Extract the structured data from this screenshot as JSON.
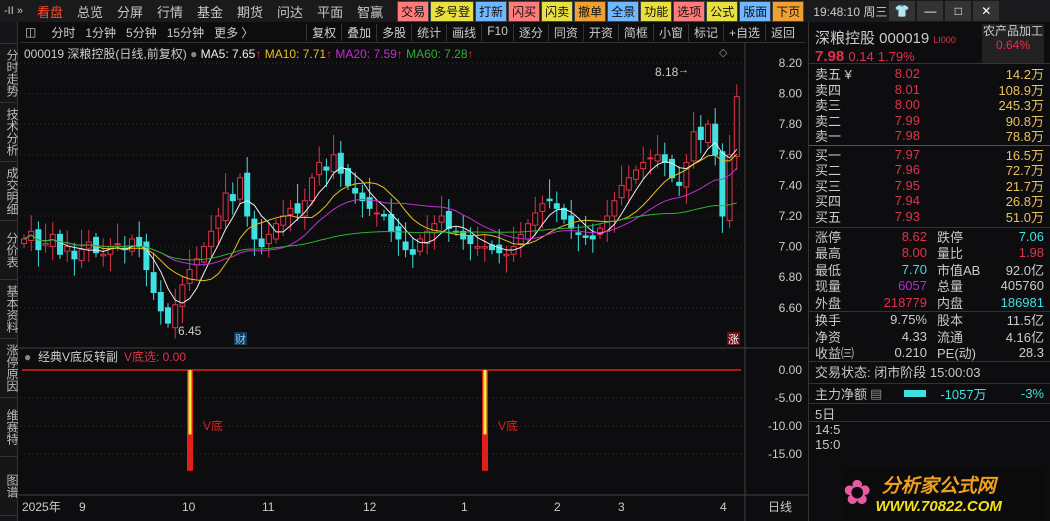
{
  "topbar": {
    "logo": "-II »",
    "nav": [
      "看盘",
      "总览",
      "分屏",
      "行情",
      "基金",
      "期货",
      "问达",
      "平面",
      "智赢"
    ],
    "functions": [
      {
        "label": "交易",
        "color": "#ff7a7a"
      },
      {
        "label": "多号登",
        "color": "#e8e040"
      },
      {
        "label": "打新",
        "color": "#6fb8ff"
      },
      {
        "label": "闪买",
        "color": "#ff7a7a"
      },
      {
        "label": "闪卖",
        "color": "#e8e040"
      },
      {
        "label": "撤单",
        "color": "#f0a030"
      },
      {
        "label": "全景",
        "color": "#6fb8ff"
      },
      {
        "label": "功能",
        "color": "#e8e040"
      },
      {
        "label": "选项",
        "color": "#ff7a7a"
      },
      {
        "label": "公式",
        "color": "#e8e040"
      },
      {
        "label": "版面",
        "color": "#6fb8ff"
      },
      {
        "label": "下页",
        "color": "#f0a030"
      }
    ],
    "clock": "19:48:10 周三"
  },
  "toolbar": {
    "left": [
      "分时",
      "1分钟",
      "5分钟",
      "15分钟",
      "更多 〉"
    ],
    "right": [
      "复权",
      "叠加",
      "多股",
      "统计",
      "画线",
      "F10",
      "逐分",
      "同资",
      "开资",
      "简框",
      "小窗",
      "标记",
      "+自选",
      "返回"
    ]
  },
  "sidebar": [
    "分时走势",
    "技术分析",
    "成交明细",
    "分价表",
    "基本资料",
    "涨停原因",
    "维赛特",
    "图谱"
  ],
  "chart": {
    "title": "000019 深粮控股(日线,前复权)",
    "ma5": "MA5: 7.65",
    "ma10": "MA10: 7.71",
    "ma20": "MA20: 7.59",
    "ma60": "MA60: 7.28",
    "high_label": "8.18",
    "low_label": "6.45",
    "marker_cai": "财",
    "marker_zhang": "涨",
    "y_ticks": [
      "8.20",
      "8.00",
      "7.80",
      "7.60",
      "7.40",
      "7.20",
      "7.00",
      "6.80",
      "6.60"
    ],
    "indicator_title": "经典V底反转副",
    "indicator_value": "V底选: 0.00",
    "indicator_ticks": [
      "0.00",
      "-5.00",
      "-10.00",
      "-15.00"
    ],
    "signal_label": "V底",
    "x_labels": [
      "2025年",
      "9",
      "10",
      "11",
      "12",
      "1",
      "2",
      "3",
      "4"
    ],
    "period": "日线"
  },
  "chart_data": {
    "type": "candlestick",
    "closes": [
      7.05,
      7.1,
      6.98,
      7.02,
      7.08,
      6.95,
      7.0,
      6.92,
      6.98,
      7.03,
      6.96,
      6.95,
      7.0,
      7.02,
      6.98,
      7.05,
      7.0,
      6.85,
      6.7,
      6.58,
      6.5,
      6.62,
      6.75,
      6.85,
      6.92,
      7.0,
      7.1,
      7.2,
      7.35,
      7.3,
      7.45,
      7.2,
      7.05,
      7.0,
      7.08,
      7.15,
      7.2,
      7.25,
      7.22,
      7.3,
      7.45,
      7.55,
      7.5,
      7.6,
      7.48,
      7.4,
      7.35,
      7.3,
      7.25,
      7.22,
      7.2,
      7.1,
      7.05,
      6.98,
      6.95,
      7.05,
      7.1,
      7.15,
      7.2,
      7.12,
      7.1,
      7.05,
      7.02,
      7.0,
      7.0,
      6.98,
      6.96,
      6.95,
      7.0,
      7.08,
      7.15,
      7.22,
      7.28,
      7.3,
      7.25,
      7.18,
      7.12,
      7.08,
      7.06,
      7.05,
      7.12,
      7.2,
      7.3,
      7.4,
      7.45,
      7.5,
      7.55,
      7.58,
      7.6,
      7.55,
      7.45,
      7.4,
      7.55,
      7.75,
      7.7,
      7.8,
      7.6,
      7.2,
      7.6,
      7.98
    ],
    "ylim": [
      6.4,
      8.3
    ],
    "signal_indices": [
      23,
      66
    ],
    "signal_value": -18
  },
  "quote": {
    "name": "深粮控股 000019",
    "tag": "LI000",
    "sector": "农产品加工",
    "sector_pct": "0.64%",
    "price": "7.98",
    "change": "0.14",
    "pct": "1.79%",
    "asks": [
      {
        "l": "卖五 ¥",
        "p": "8.02",
        "v": "14.2万"
      },
      {
        "l": "卖四",
        "p": "8.01",
        "v": "108.9万"
      },
      {
        "l": "卖三",
        "p": "8.00",
        "v": "245.3万"
      },
      {
        "l": "卖二",
        "p": "7.99",
        "v": "90.8万"
      },
      {
        "l": "卖一",
        "p": "7.98",
        "v": "78.8万"
      }
    ],
    "bids": [
      {
        "l": "买一",
        "p": "7.97",
        "v": "16.5万"
      },
      {
        "l": "买二",
        "p": "7.96",
        "v": "72.7万"
      },
      {
        "l": "买三",
        "p": "7.95",
        "v": "21.7万"
      },
      {
        "l": "买四",
        "p": "7.94",
        "v": "26.8万"
      },
      {
        "l": "买五",
        "p": "7.93",
        "v": "51.0万"
      }
    ],
    "stats1": [
      [
        "涨停",
        "8.62",
        "red",
        "跌停",
        "7.06",
        "cyan"
      ],
      [
        "最高",
        "8.00",
        "red",
        "量比",
        "1.98",
        "red"
      ],
      [
        "最低",
        "7.70",
        "cyan",
        "市值AB",
        "92.0亿",
        "wht"
      ],
      [
        "现量",
        "6057",
        "pur",
        "总量",
        "405760",
        "wht"
      ],
      [
        "外盘",
        "218779",
        "red",
        "内盘",
        "186981",
        "cyan"
      ]
    ],
    "stats2": [
      [
        "换手",
        "9.75%",
        "wht",
        "股本",
        "11.5亿",
        "wht"
      ],
      [
        "净资",
        "4.33",
        "wht",
        "流通",
        "4.16亿",
        "wht"
      ],
      [
        "收益㈢",
        "0.210",
        "wht",
        "PE(动)",
        "28.3",
        "wht"
      ]
    ],
    "status": "交易状态: 闭市阶段 15:00:03",
    "main_flow_label": "主力净额",
    "main_flow_value": "-1057万",
    "main_flow_pct": "-3%",
    "five_day": "5日",
    "t1": "14:5",
    "t2": "15:0"
  },
  "watermark": {
    "title": "分析家公式网",
    "url": "WWW.70822.COM"
  }
}
